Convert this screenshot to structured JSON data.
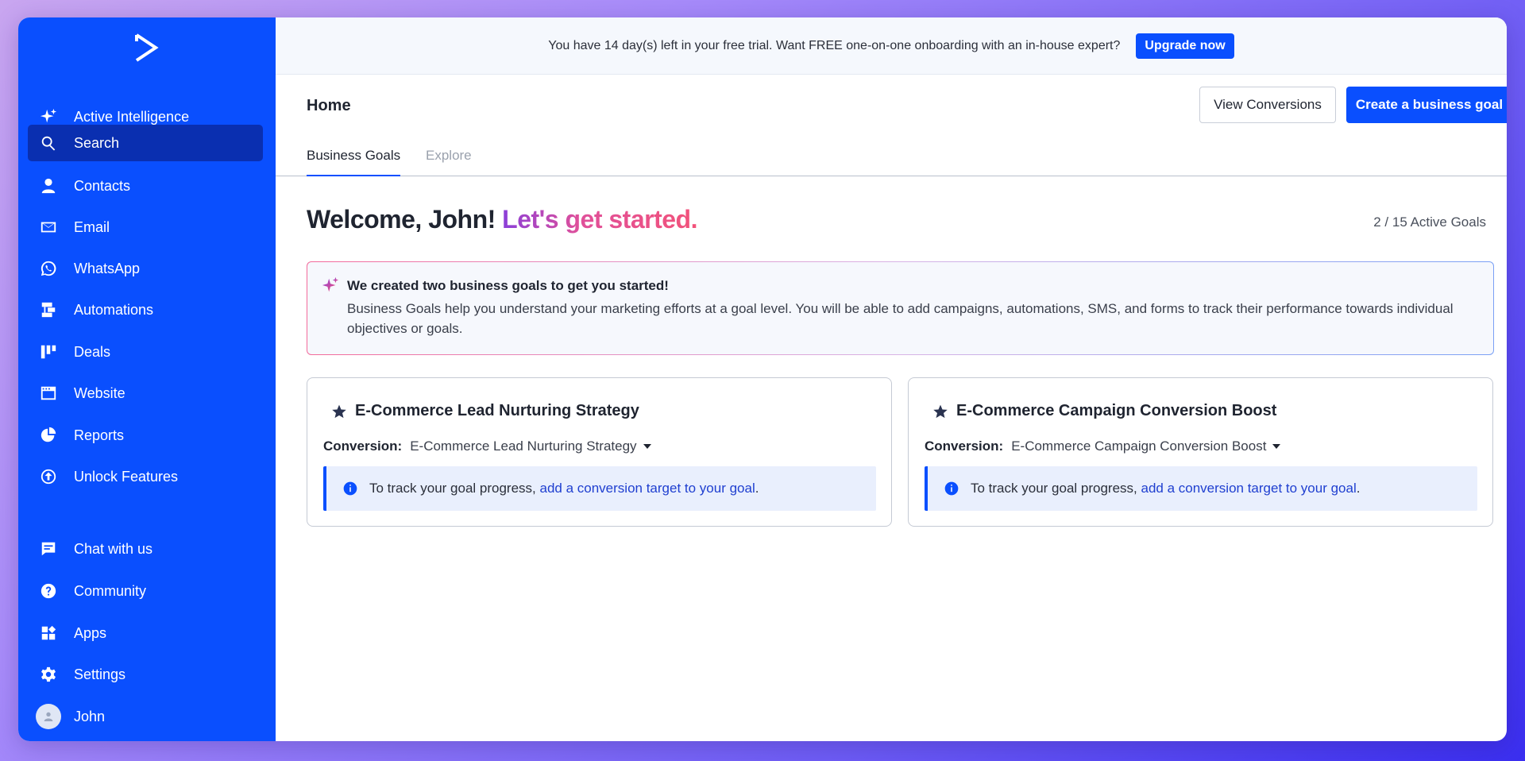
{
  "sidebar": {
    "items": [
      {
        "label": "Active Intelligence",
        "icon": "sparkle-icon"
      },
      {
        "label": "Search",
        "icon": "search-icon",
        "active": true
      },
      {
        "label": "Contacts",
        "icon": "person-icon"
      },
      {
        "label": "Email",
        "icon": "envelope-icon"
      },
      {
        "label": "WhatsApp",
        "icon": "whatsapp-icon"
      },
      {
        "label": "Automations",
        "icon": "automation-icon"
      },
      {
        "label": "Deals",
        "icon": "deals-icon"
      },
      {
        "label": "Website",
        "icon": "website-icon"
      },
      {
        "label": "Reports",
        "icon": "pie-chart-icon"
      },
      {
        "label": "Unlock Features",
        "icon": "arrow-up-circle-icon"
      }
    ],
    "bottom_items": [
      {
        "label": "Chat with us",
        "icon": "chat-icon"
      },
      {
        "label": "Community",
        "icon": "help-icon"
      },
      {
        "label": "Apps",
        "icon": "apps-icon"
      },
      {
        "label": "Settings",
        "icon": "gear-icon"
      },
      {
        "label": "John",
        "icon": "avatar"
      }
    ]
  },
  "trial": {
    "message": "You have 14 day(s) left in your free trial. Want FREE one-on-one onboarding with an in-house expert?",
    "upgrade_label": "Upgrade now"
  },
  "header": {
    "title": "Home",
    "view_conversions_label": "View Conversions",
    "create_goal_label": "Create a business goal"
  },
  "tabs": [
    {
      "label": "Business Goals",
      "active": true
    },
    {
      "label": "Explore",
      "active": false
    }
  ],
  "welcome": {
    "greeting": "Welcome, John!",
    "highlight": "Let's get started.",
    "active_goals": "2 / 15 Active Goals"
  },
  "banner": {
    "title": "We created two business goals to get you started!",
    "body": "Business Goals help you understand your marketing efforts at a goal level. You will be able to add campaigns, automations, SMS, and forms to track their performance towards individual objectives or goals."
  },
  "goals": [
    {
      "title": "E-Commerce Lead Nurturing Strategy",
      "conversion_label": "Conversion:",
      "conversion_value": "E-Commerce Lead Nurturing Strategy",
      "notice_text": "To track your goal progress,",
      "notice_link": "add a conversion target to your goal",
      "notice_end": "."
    },
    {
      "title": "E-Commerce Campaign Conversion Boost",
      "conversion_label": "Conversion:",
      "conversion_value": "E-Commerce Campaign Conversion Boost",
      "notice_text": "To track your goal progress,",
      "notice_link": "add a conversion target to your goal",
      "notice_end": "."
    }
  ],
  "colors": {
    "brand": "#0a4ffe",
    "sidebar_active": "#0a2fb0",
    "text": "#1f2430",
    "link": "#1f3fd0"
  }
}
